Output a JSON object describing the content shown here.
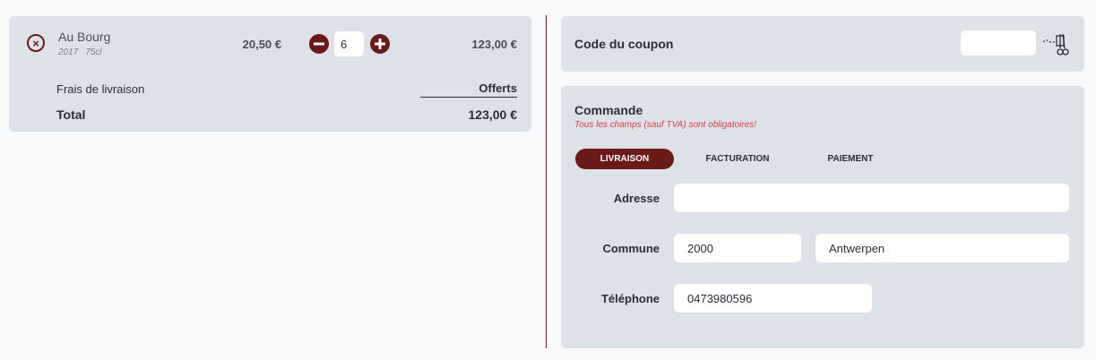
{
  "cart": {
    "product": {
      "name": "Au Bourg",
      "year": "2017",
      "volume": "75cl",
      "unit_price": "20,50 €",
      "quantity": "6",
      "line_total": "123,00 €"
    },
    "shipping_label": "Frais de livraison",
    "shipping_value": "Offerts",
    "total_label": "Total",
    "total_value": "123,00 €"
  },
  "coupon": {
    "label": "Code du coupon",
    "value": ""
  },
  "order": {
    "title": "Commande",
    "note": "Tous les champs (sauf TVA) sont obligatoires!",
    "tabs": [
      "LIVRAISON",
      "FACTURATION",
      "PAIEMENT"
    ],
    "active_tab": "LIVRAISON",
    "fields": {
      "adresse_label": "Adresse",
      "adresse_value": "",
      "commune_label": "Commune",
      "postcode_value": "2000",
      "city_value": "Antwerpen",
      "telephone_label": "Téléphone",
      "telephone_value": "0473980596"
    }
  },
  "colors": {
    "accent": "#6b1a1a",
    "panel": "#dde2e8",
    "warning": "#d3414a"
  },
  "icons": {
    "remove": "remove-circle-x-icon",
    "minus": "minus-circle-icon",
    "plus": "plus-circle-icon",
    "coupon": "scissors-coupon-icon"
  }
}
